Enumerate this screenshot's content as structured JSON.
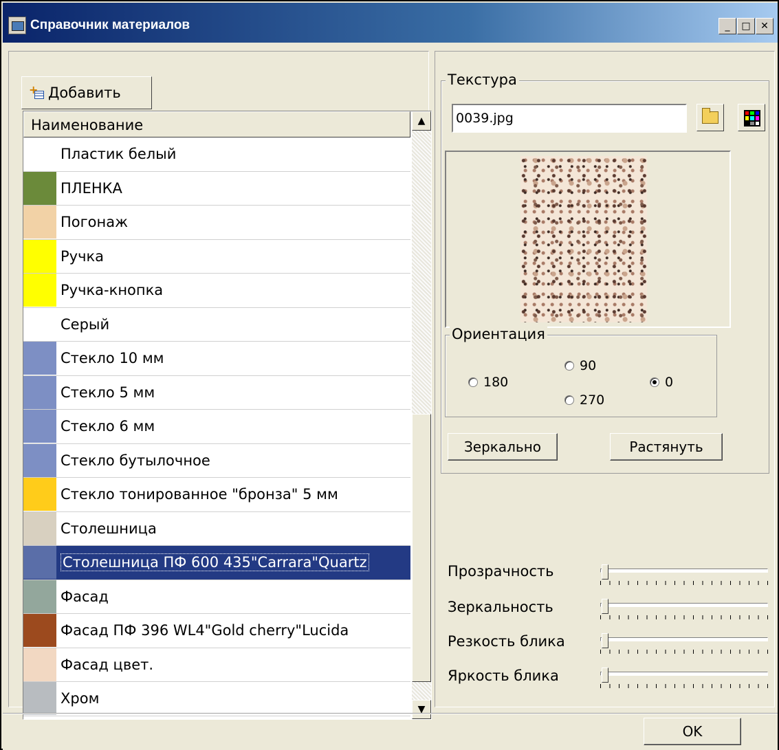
{
  "window": {
    "title": "Справочник материалов",
    "minimize_glyph": "_",
    "maximize_glyph": "□",
    "close_glyph": "✕"
  },
  "toolbar": {
    "add_label": "Добавить"
  },
  "list": {
    "column_header": "Наименование",
    "items": [
      {
        "label": "Пластик белый",
        "swatch": "#ffffff"
      },
      {
        "label": "ПЛЕНКА",
        "swatch": "#6b8a3a"
      },
      {
        "label": "Погонаж",
        "swatch": "#f2d2a6"
      },
      {
        "label": "Ручка",
        "swatch": "#ffff00"
      },
      {
        "label": "Ручка-кнопка",
        "swatch": "#ffff00"
      },
      {
        "label": "Серый",
        "swatch": "#ffffff"
      },
      {
        "label": "Стекло 10 мм",
        "swatch": "#7d8fc4"
      },
      {
        "label": "Стекло 5 мм",
        "swatch": "#7d8fc4"
      },
      {
        "label": "Стекло 6 мм",
        "swatch": "#7d8fc4"
      },
      {
        "label": "Стекло бутылочное",
        "swatch": "#7d8fc4"
      },
      {
        "label": "Стекло тонированное \"бронза\" 5 мм",
        "swatch": "#ffcc1a"
      },
      {
        "label": "Столешница",
        "swatch": "#d8d0c0"
      },
      {
        "label": "Столешница ПФ 600 435\"Carrara\"Quartz",
        "swatch": "#5a6ea8",
        "selected": true
      },
      {
        "label": "Фасад",
        "swatch": "#93a79c"
      },
      {
        "label": "Фасад ПФ 396 WL4\"Gold cherry\"Lucida",
        "swatch": "#9c4a1e"
      },
      {
        "label": "Фасад цвет.",
        "swatch": "#f2d8c2"
      },
      {
        "label": "Хром",
        "swatch": "#b8bcc0"
      }
    ]
  },
  "texture": {
    "legend": "Текстура",
    "file": "0039.jpg",
    "orientation": {
      "legend": "Ориентация",
      "options": [
        "180",
        "90",
        "270",
        "0"
      ],
      "selected": "0"
    },
    "mirror_label": "Зеркально",
    "stretch_label": "Растянуть"
  },
  "sliders": [
    {
      "label": "Прозрачность",
      "value": 0
    },
    {
      "label": "Зеркальность",
      "value": 0
    },
    {
      "label": "Резкость блика",
      "value": 0
    },
    {
      "label": "Яркость блика",
      "value": 0
    }
  ],
  "footer": {
    "ok_label": "OK"
  }
}
